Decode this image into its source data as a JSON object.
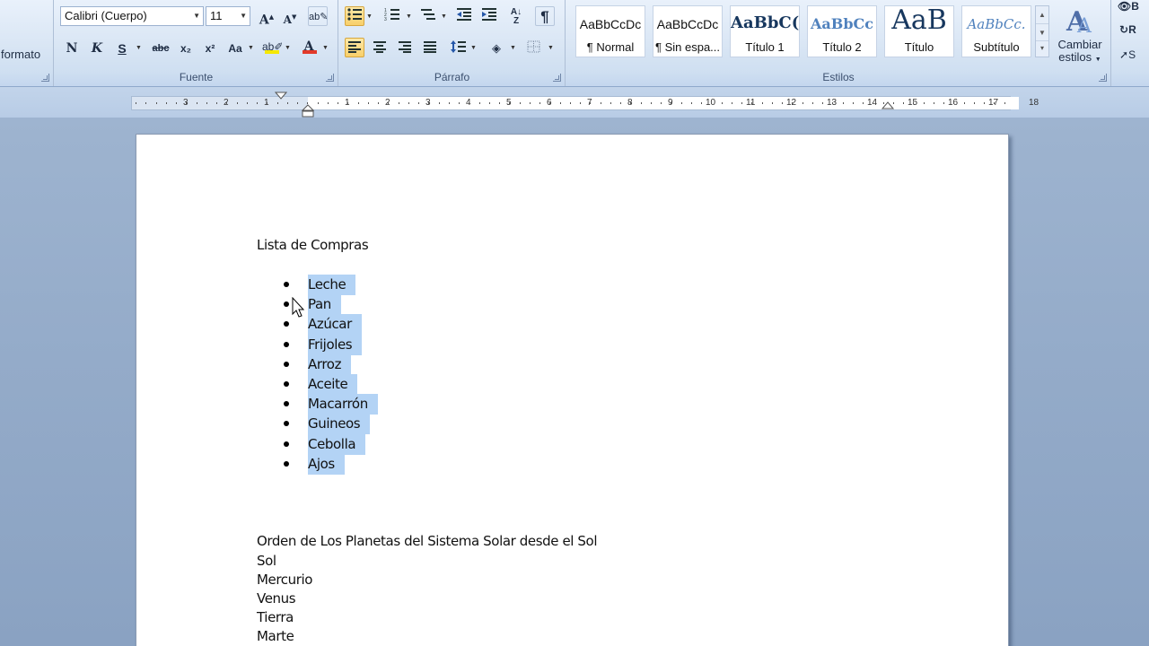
{
  "ribbon": {
    "left_group": {
      "label_partial": "formato"
    },
    "font": {
      "label": "Fuente",
      "font_name": "Calibri (Cuerpo)",
      "font_size": "11",
      "grow": "A",
      "shrink": "A",
      "bold": "N",
      "italic": "K",
      "strike": "abc",
      "sub": "x₂",
      "sup": "x²",
      "case": "Aa",
      "font_color": "A",
      "accent_colors": {
        "highlight": "#f5e800",
        "font_color": "#e23a2a"
      }
    },
    "paragraph": {
      "label": "Párrafo",
      "pilcrow": "¶"
    },
    "styles": {
      "label": "Estilos",
      "items": [
        {
          "sample": "AaBbCcDc",
          "name": "¶ Normal"
        },
        {
          "sample": "AaBbCcDc",
          "name": "¶ Sin espa..."
        },
        {
          "sample": "AaBbC(",
          "name": "Título 1"
        },
        {
          "sample": "AaBbCc",
          "name": "Título 2"
        },
        {
          "sample": "AaB",
          "name": "Título"
        },
        {
          "sample": "AaBbCc.",
          "name": "Subtítulo"
        }
      ],
      "change_styles": {
        "line1": "Cambiar",
        "line2": "estilos"
      }
    },
    "edit_partial": {
      "b1": "B",
      "b2": "R",
      "b3": "S"
    }
  },
  "ruler": {
    "left_numbers": [
      "3",
      "2",
      "1"
    ],
    "right_numbers": [
      "1",
      "2",
      "3",
      "4",
      "5",
      "6",
      "7",
      "8",
      "9",
      "10",
      "11",
      "12",
      "13",
      "14",
      "15",
      "16",
      "17",
      "18"
    ]
  },
  "document": {
    "heading1": "Lista de Compras",
    "list_items": [
      "Leche",
      "Pan",
      "Azúcar",
      "Frijoles",
      "Arroz",
      "Aceite",
      "Macarrón",
      "Guineos",
      "Cebolla",
      "Ajos"
    ],
    "heading2": "Orden de Los Planetas del Sistema Solar desde el Sol",
    "planets": [
      "Sol",
      "Mercurio",
      "Venus",
      "Tierra",
      "Marte"
    ],
    "selection_color": "#b3d3f5"
  }
}
